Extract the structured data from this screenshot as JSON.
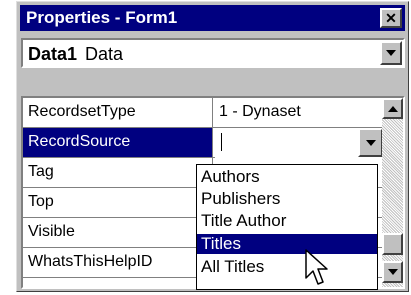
{
  "window": {
    "title": "Properties - Form1",
    "close_glyph": "✕"
  },
  "object_combo": {
    "name": "Data1",
    "type": "Data"
  },
  "properties": [
    {
      "name": "RecordsetType",
      "value": "1 - Dynaset"
    },
    {
      "name": "RecordSource",
      "value": ""
    },
    {
      "name": "Tag",
      "value": ""
    },
    {
      "name": "Top",
      "value": ""
    },
    {
      "name": "Visible",
      "value": ""
    },
    {
      "name": "WhatsThisHelpID",
      "value": ""
    }
  ],
  "selected_property": "RecordSource",
  "dropdown_options": [
    "Authors",
    "Publishers",
    "Title Author",
    "Titles",
    "All Titles"
  ],
  "highlighted_option": "Titles",
  "colors": {
    "title_bar": "#000080",
    "selection": "#000080",
    "face": "#c0c0c0"
  },
  "icons": {
    "close": "close-icon",
    "dropdown": "chevron-down-icon",
    "scroll_up": "scroll-up-icon",
    "scroll_down": "scroll-down-icon",
    "cursor": "arrow-cursor-icon"
  }
}
